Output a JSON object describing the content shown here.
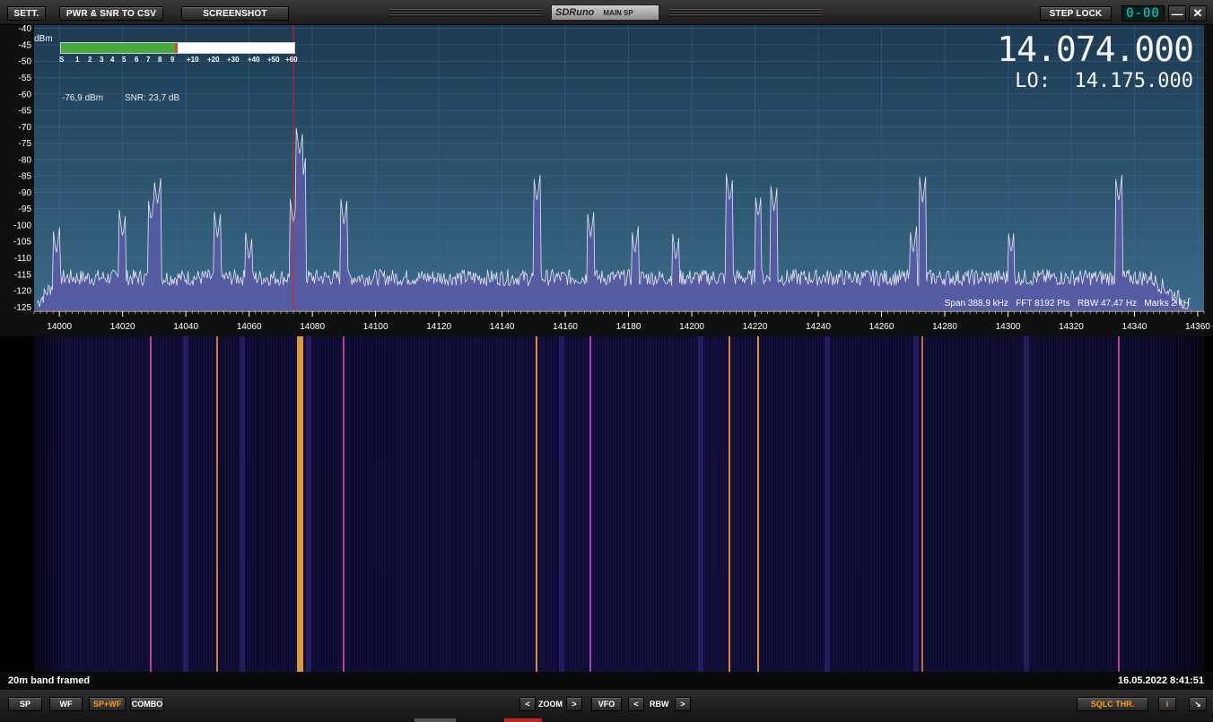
{
  "titlebar": {
    "settings_label": "SETT.",
    "csv_label": "PWR & SNR TO CSV",
    "screenshot_label": "SCREENSHOT",
    "brand": "SDRuno",
    "window_name": "MAIN SP",
    "step_lock_label": "STEP LOCK",
    "led_display": "0-00",
    "minimize_icon": "minimize-icon",
    "close_icon": "close-icon"
  },
  "spectrum": {
    "dbm_unit": "dBm",
    "smeter_scale": [
      "S",
      "1",
      "2",
      "3",
      "4",
      "5",
      "6",
      "7",
      "8",
      "9",
      "+10",
      "+20",
      "+30",
      "+40",
      "+50",
      "+60"
    ],
    "smeter_level": 0.49,
    "power": "-76,9 dBm",
    "snr": "SNR: 23,7 dB",
    "vfo_frequency": "14.074.000",
    "lo_label": "LO:",
    "lo_frequency": "14.175.000",
    "info": "Span 388,9 kHz   FFT 8192 Pts   RBW 47,47 Hz   Marks 2 kH",
    "colors": {
      "trace": "#e6e6f2",
      "fill": "#5c5aa8",
      "marker": "#d8241c",
      "grid": "#3f6c9e"
    }
  },
  "chart_data": {
    "type": "line",
    "title": "",
    "xlabel": "",
    "ylabel": "dBm",
    "xlim": [
      13992,
      14362
    ],
    "ylim": [
      -126,
      -39
    ],
    "x_ticks": [
      14000,
      14020,
      14040,
      14060,
      14080,
      14100,
      14120,
      14140,
      14160,
      14180,
      14200,
      14220,
      14240,
      14260,
      14280,
      14300,
      14320,
      14340,
      14360
    ],
    "y_ticks": [
      -40,
      -45,
      -50,
      -55,
      -60,
      -65,
      -70,
      -75,
      -80,
      -85,
      -90,
      -95,
      -100,
      -105,
      -110,
      -115,
      -120,
      -125
    ],
    "grid": true,
    "noise_floor": -116,
    "marker_freq": 14074,
    "peaks": [
      {
        "x": 13999,
        "y": -109
      },
      {
        "x": 14020,
        "y": -104
      },
      {
        "x": 14029,
        "y": -99
      },
      {
        "x": 14031,
        "y": -94
      },
      {
        "x": 14050,
        "y": -104
      },
      {
        "x": 14060,
        "y": -111
      },
      {
        "x": 14074,
        "y": -100
      },
      {
        "x": 14076,
        "y": -79
      },
      {
        "x": 14077,
        "y": -86
      },
      {
        "x": 14090,
        "y": -100
      },
      {
        "x": 14151,
        "y": -93
      },
      {
        "x": 14168,
        "y": -104
      },
      {
        "x": 14182,
        "y": -109
      },
      {
        "x": 14195,
        "y": -111
      },
      {
        "x": 14212,
        "y": -93
      },
      {
        "x": 14221,
        "y": -98
      },
      {
        "x": 14226,
        "y": -96
      },
      {
        "x": 14270,
        "y": -109
      },
      {
        "x": 14273,
        "y": -93
      },
      {
        "x": 14301,
        "y": -109
      },
      {
        "x": 14335,
        "y": -93
      }
    ]
  },
  "waterfall": {
    "signal_lines": [
      {
        "x": 14029,
        "color": "#e04aa0"
      },
      {
        "x": 14050,
        "color": "#e8942a"
      },
      {
        "x": 14076,
        "color": "#ffb43c"
      },
      {
        "x": 14090,
        "color": "#d84a9a"
      },
      {
        "x": 14151,
        "color": "#ff9c30"
      },
      {
        "x": 14168,
        "color": "#c04ad0"
      },
      {
        "x": 14212,
        "color": "#ff9c30"
      },
      {
        "x": 14221,
        "color": "#ffb030"
      },
      {
        "x": 14273,
        "color": "#e8802a"
      },
      {
        "x": 14335,
        "color": "#d84a9a"
      }
    ],
    "colors": {
      "bg": "#0c0a2a"
    }
  },
  "status": {
    "left": "20m band framed",
    "right": "16.05.2022 8:41:51"
  },
  "bottom": {
    "sp": "SP",
    "wf": "WF",
    "spwf": "SP+WF",
    "combo": "COMBO",
    "zoom": "ZOOM",
    "vfo": "VFO",
    "rbw": "RBW",
    "sqlc": "SQLC THR.",
    "info": "i",
    "left_arrow": "<",
    "right_arrow": ">",
    "resize_icon": "resize-icon"
  }
}
